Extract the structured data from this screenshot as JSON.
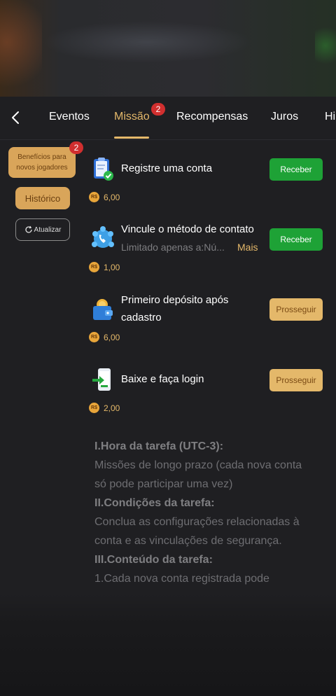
{
  "tabs": [
    {
      "label": "Eventos"
    },
    {
      "label": "Missão",
      "badge": "2"
    },
    {
      "label": "Recompensas"
    },
    {
      "label": "Juros"
    },
    {
      "label": "Hi"
    }
  ],
  "sidebar": {
    "benefits_label_line1": "Benefícios para",
    "benefits_label_line2": "novos jogadores",
    "benefits_badge": "2",
    "history_label": "Histórico",
    "refresh_label": "Atualizar"
  },
  "tasks": [
    {
      "title": "Registre uma conta",
      "reward_currency": "R$",
      "reward": "6,00",
      "button": "Receber",
      "icon": "clipboard-check-icon"
    },
    {
      "title": "Vincule o método de contato",
      "subtitle": "Limitado apenas a:Nú...",
      "more": "Mais",
      "reward_currency": "R$",
      "reward": "1,00",
      "button": "Receber",
      "icon": "contact-phone-icon"
    },
    {
      "title_line1": "Primeiro depósito após",
      "title_line2": "cadastro",
      "reward_currency": "R$",
      "reward": "6,00",
      "button": "Prosseguir",
      "icon": "wallet-coin-icon"
    },
    {
      "title": "Baixe e faça login",
      "reward_currency": "R$",
      "reward": "2,00",
      "button": "Prosseguir",
      "icon": "download-app-icon"
    }
  ],
  "rules": {
    "h1": "I.Hora da tarefa (UTC-3):",
    "p1_line1": "Missões de longo prazo (cada nova conta",
    "p1_line2": "só pode participar uma vez)",
    "h2": "II.Condições da tarefa:",
    "p2_line1": "Conclua as configurações relacionadas à",
    "p2_line2": "conta e as vinculações de segurança.",
    "h3": "III.Conteúdo da tarefa:",
    "p3_line1": "1.Cada nova conta registrada pode"
  },
  "colors": {
    "accent": "#e4b86a",
    "green_button": "#1ea236",
    "badge": "#d12f2f",
    "background": "#1f1f22"
  }
}
